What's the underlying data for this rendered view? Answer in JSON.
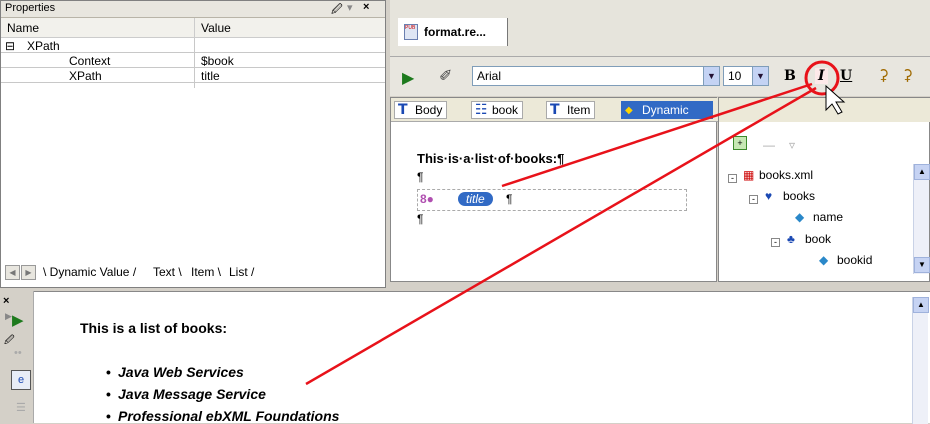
{
  "properties": {
    "title": "Properties",
    "pin": "p",
    "close": "×",
    "columns": [
      "Name",
      "Value"
    ],
    "rows": [
      {
        "name": "XPath",
        "value": "",
        "toggle": "⊟"
      },
      {
        "name": "Context",
        "value": "$book"
      },
      {
        "name": "XPath",
        "value": "title"
      }
    ],
    "tabs": [
      "Dynamic Value",
      "Text",
      "Item",
      "List"
    ]
  },
  "editor": {
    "tab_label": "format.re...",
    "font_name": "Arial",
    "font_size": "10",
    "bold": "B",
    "italic": "I",
    "underline": "U"
  },
  "design": {
    "tabs": [
      {
        "icon": "T",
        "label": "Body"
      },
      {
        "icon": "☷",
        "label": "book"
      },
      {
        "icon": "T",
        "label": "Item"
      },
      {
        "icon": "◆",
        "label": "Dynamic"
      }
    ],
    "heading": "This·is·a·list·of·books:¶",
    "pilcrow": "¶",
    "title_tag": "title"
  },
  "tree": {
    "nodes": [
      {
        "label": "books.xml"
      },
      {
        "label": "books"
      },
      {
        "label": "name"
      },
      {
        "label": "book"
      },
      {
        "label": "bookid"
      }
    ]
  },
  "preview": {
    "heading": "This is a list of books:",
    "items": [
      "Java Web Services",
      "Java Message Service",
      "Professional ebXML Foundations"
    ]
  },
  "colors": {
    "accent": "#316ac5",
    "annotation": "#e8121a"
  }
}
